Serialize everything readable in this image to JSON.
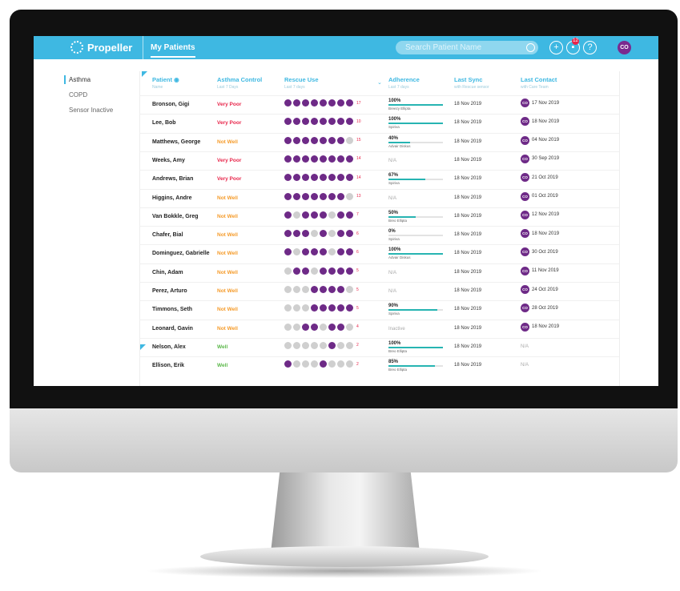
{
  "app": {
    "brand": "Propeller",
    "tab": "My Patients"
  },
  "search": {
    "placeholder": "Search Patient Name"
  },
  "toolbar": {
    "badge": "12",
    "avatar": "CO"
  },
  "sidebar": {
    "items": [
      {
        "label": "Asthma"
      },
      {
        "label": "COPD"
      },
      {
        "label": "Sensor Inactive"
      }
    ]
  },
  "columns": [
    {
      "title": "Patient",
      "sub": "Name"
    },
    {
      "title": "Asthma Control",
      "sub": "Last 7 Days"
    },
    {
      "title": "Rescue Use",
      "sub": "Last 7 days"
    },
    {
      "title": "Adherence",
      "sub": "Last 7 days"
    },
    {
      "title": "Last Sync",
      "sub": "with Rescue sensor"
    },
    {
      "title": "Last Contact",
      "sub": "with Care Team"
    }
  ],
  "colors": {
    "very_poor": "#e8254a",
    "not_well": "#f59b2a",
    "well": "#5bb84a",
    "accent": "#3eb8e2",
    "purple": "#6e2a87"
  },
  "rows": [
    {
      "name": "Bronson, Gigi",
      "control": "Very Poor",
      "level": "very_poor",
      "dots": [
        1,
        1,
        1,
        1,
        1,
        1,
        1,
        1
      ],
      "count": "17",
      "adh": "100%",
      "adh_pct": 1.0,
      "adh_sub": "Breezy Ellipta",
      "sync": "18 Nov 2019",
      "contact": "17 Nov 2019",
      "has_contact": true
    },
    {
      "name": "Lee, Bob",
      "control": "Very Poor",
      "level": "very_poor",
      "dots": [
        1,
        1,
        1,
        1,
        1,
        1,
        1,
        1
      ],
      "count": "10",
      "adh": "100%",
      "adh_pct": 1.0,
      "adh_sub": "Spiriva",
      "sync": "18 Nov 2019",
      "contact": "18 Nov 2019",
      "has_contact": true
    },
    {
      "name": "Matthews, George",
      "control": "Not Well",
      "level": "not_well",
      "dots": [
        1,
        1,
        1,
        1,
        1,
        1,
        1,
        0
      ],
      "count": "15",
      "adh": "40%",
      "adh_pct": 0.4,
      "adh_sub": "Advair Diskus",
      "sync": "18 Nov 2019",
      "contact": "04 Nov 2019",
      "has_contact": true
    },
    {
      "name": "Weeks, Amy",
      "control": "Very Poor",
      "level": "very_poor",
      "dots": [
        1,
        1,
        1,
        1,
        1,
        1,
        1,
        1
      ],
      "count": "14",
      "adh": "N/A",
      "adh_pct": null,
      "adh_sub": "",
      "sync": "18 Nov 2019",
      "contact": "30 Sep 2019",
      "has_contact": true
    },
    {
      "name": "Andrews, Brian",
      "control": "Very Poor",
      "level": "very_poor",
      "dots": [
        1,
        1,
        1,
        1,
        1,
        1,
        1,
        1
      ],
      "count": "14",
      "adh": "67%",
      "adh_pct": 0.67,
      "adh_sub": "Spiriva",
      "sync": "18 Nov 2019",
      "contact": "21 Oct 2019",
      "has_contact": true
    },
    {
      "name": "Higgins, Andre",
      "control": "Not Well",
      "level": "not_well",
      "dots": [
        1,
        1,
        1,
        1,
        1,
        1,
        1,
        0
      ],
      "count": "13",
      "adh": "N/A",
      "adh_pct": null,
      "adh_sub": "",
      "sync": "18 Nov 2019",
      "contact": "01 Oct 2019",
      "has_contact": true
    },
    {
      "name": "Van Bokkle, Greg",
      "control": "Not Well",
      "level": "not_well",
      "dots": [
        1,
        0,
        1,
        1,
        1,
        0,
        1,
        1
      ],
      "count": "7",
      "adh": "50%",
      "adh_pct": 0.5,
      "adh_sub": "Breo Ellipta",
      "sync": "18 Nov 2019",
      "contact": "12 Nov 2019",
      "has_contact": true
    },
    {
      "name": "Chafer, Bial",
      "control": "Not Well",
      "level": "not_well",
      "dots": [
        1,
        1,
        1,
        0,
        1,
        0,
        1,
        1
      ],
      "count": "6",
      "adh": "0%",
      "adh_pct": 0.0,
      "adh_sub": "Spiriva",
      "sync": "18 Nov 2019",
      "contact": "18 Nov 2019",
      "has_contact": true
    },
    {
      "name": "Dominguez, Gabrielle",
      "control": "Not Well",
      "level": "not_well",
      "dots": [
        1,
        0,
        1,
        1,
        1,
        0,
        1,
        1
      ],
      "count": "6",
      "adh": "100%",
      "adh_pct": 1.0,
      "adh_sub": "Advair Diskus",
      "sync": "18 Nov 2019",
      "contact": "30 Oct 2019",
      "has_contact": true
    },
    {
      "name": "Chin, Adam",
      "control": "Not Well",
      "level": "not_well",
      "dots": [
        0,
        1,
        1,
        0,
        1,
        1,
        1,
        1
      ],
      "count": "5",
      "adh": "N/A",
      "adh_pct": null,
      "adh_sub": "",
      "sync": "18 Nov 2019",
      "contact": "11 Nov 2019",
      "has_contact": true
    },
    {
      "name": "Perez, Arturo",
      "control": "Not Well",
      "level": "not_well",
      "dots": [
        0,
        0,
        0,
        1,
        1,
        1,
        1,
        0
      ],
      "count": "5",
      "adh": "N/A",
      "adh_pct": null,
      "adh_sub": "",
      "sync": "18 Nov 2019",
      "contact": "24 Oct 2019",
      "has_contact": true
    },
    {
      "name": "Timmons, Seth",
      "control": "Not Well",
      "level": "not_well",
      "dots": [
        0,
        0,
        0,
        1,
        1,
        1,
        1,
        1
      ],
      "count": "5",
      "adh": "90%",
      "adh_pct": 0.9,
      "adh_sub": "Spiriva",
      "sync": "18 Nov 2019",
      "contact": "28 Oct 2019",
      "has_contact": true
    },
    {
      "name": "Leonard, Gavin",
      "control": "Not Well",
      "level": "not_well",
      "dots": [
        0,
        0,
        1,
        1,
        0,
        1,
        1,
        0
      ],
      "count": "4",
      "adh": "Inactive",
      "adh_pct": null,
      "adh_sub": "",
      "sync": "18 Nov 2019",
      "contact": "18 Nov 2019",
      "has_contact": true
    },
    {
      "name": "Nelson, Alex",
      "control": "Well",
      "level": "well",
      "dots": [
        0,
        0,
        0,
        0,
        0,
        1,
        0,
        0
      ],
      "count": "2",
      "adh": "100%",
      "adh_pct": 1.0,
      "adh_sub": "Breo Ellipta",
      "sync": "18 Nov 2019",
      "contact": "N/A",
      "has_contact": false
    },
    {
      "name": "Ellison, Erik",
      "control": "Well",
      "level": "well",
      "dots": [
        1,
        0,
        0,
        0,
        1,
        0,
        0,
        0
      ],
      "count": "2",
      "adh": "85%",
      "adh_pct": 0.85,
      "adh_sub": "Breo Ellipta",
      "sync": "18 Nov 2019",
      "contact": "N/A",
      "has_contact": false
    }
  ]
}
